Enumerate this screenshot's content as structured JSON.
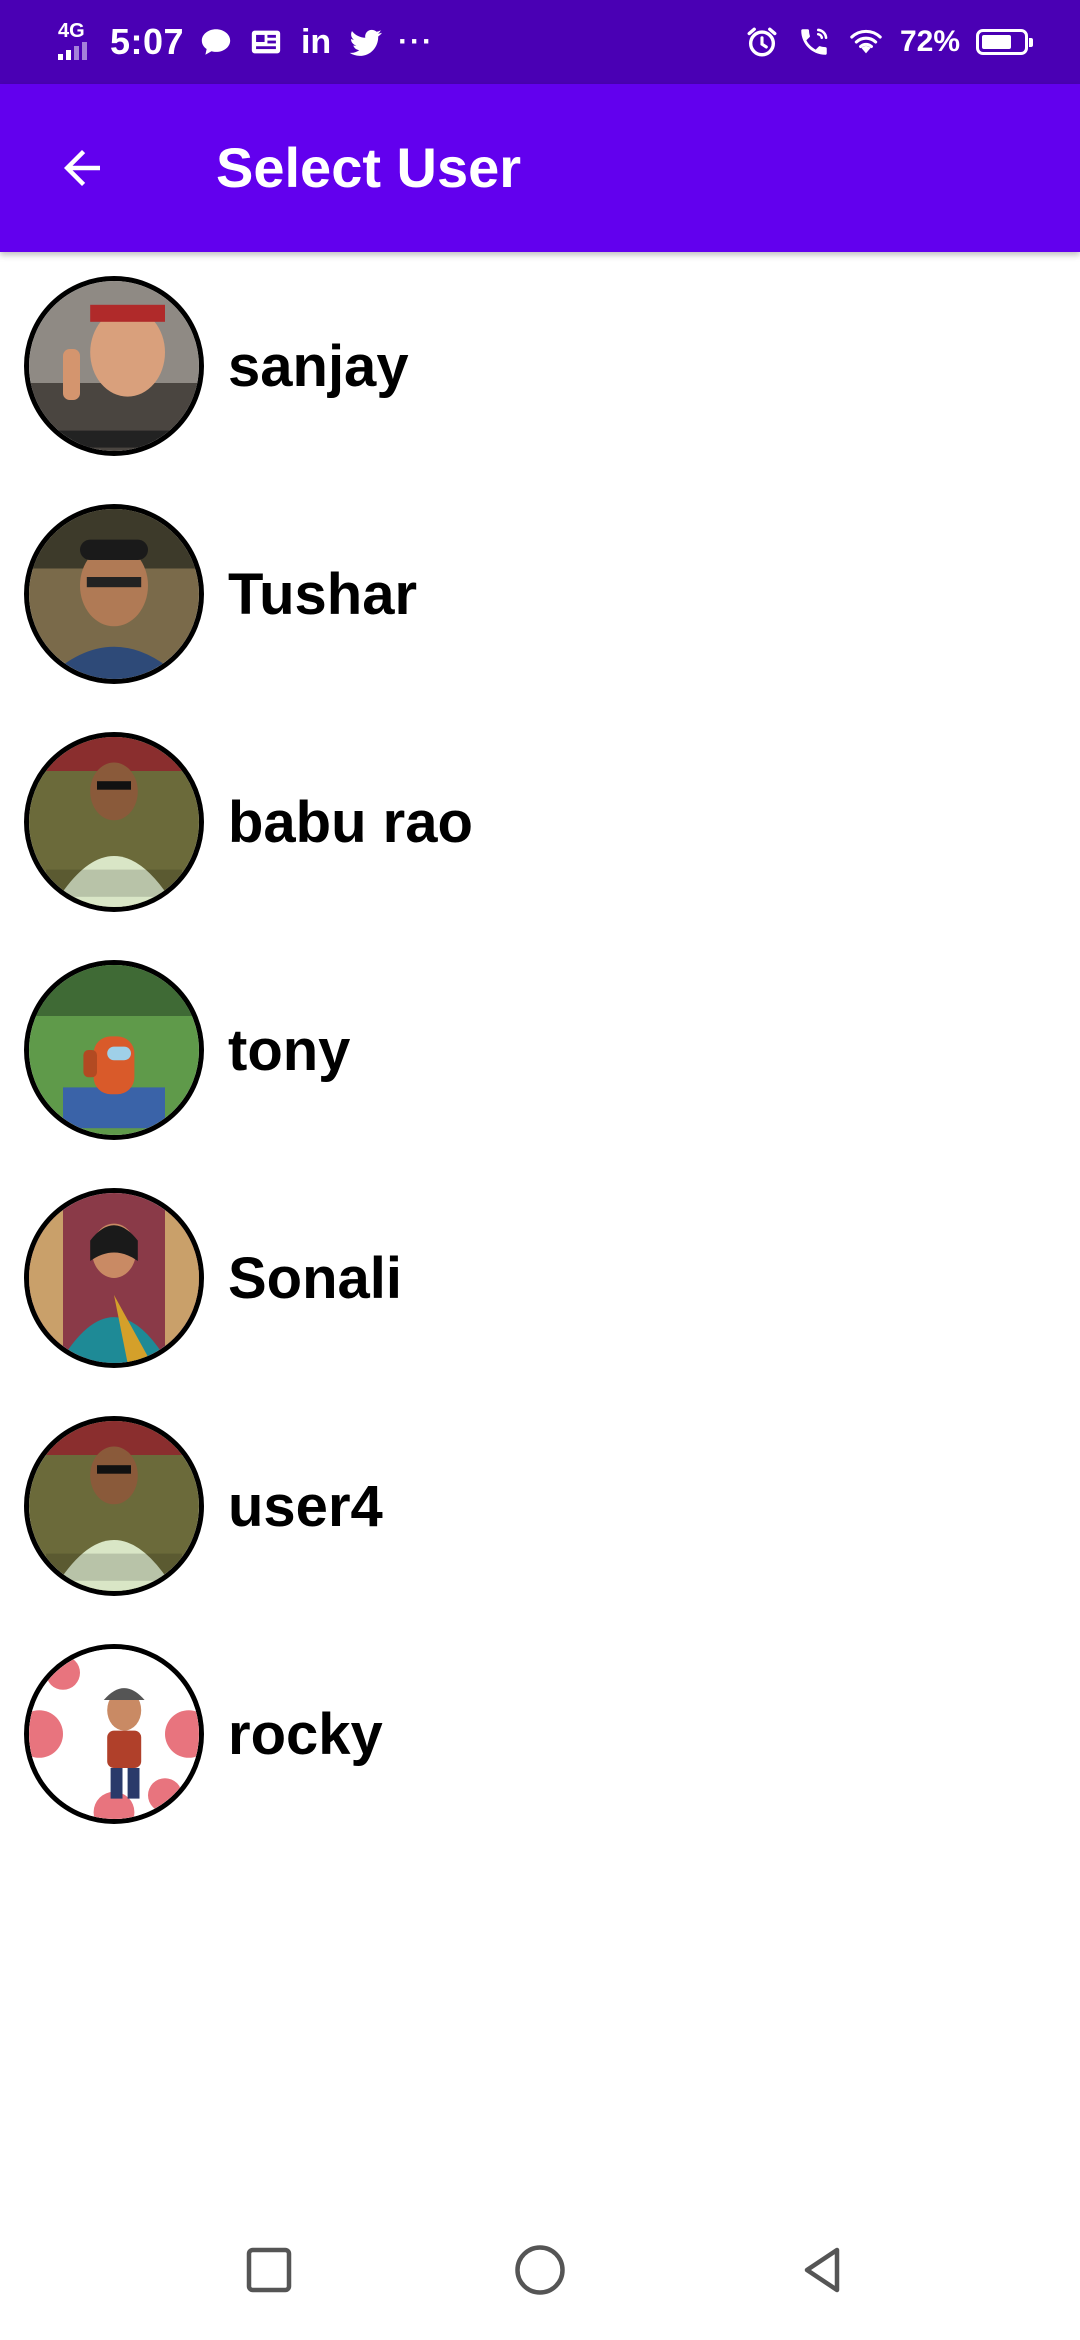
{
  "status_bar": {
    "network": "4G",
    "time": "5:07",
    "battery_percent": "72%",
    "battery_level": 0.72,
    "left_icons": [
      "chat-bubble-icon",
      "news-icon",
      "linkedin-icon",
      "twitter-icon",
      "more-dots-icon"
    ],
    "right_icons": [
      "alarm-icon",
      "wifi-calling-icon",
      "wifi-icon",
      "battery-icon"
    ],
    "linkedin_glyph": "in",
    "more_glyph": "···"
  },
  "app_bar": {
    "title": "Select User",
    "back_icon": "arrow-back-icon",
    "color": "#6200ee"
  },
  "users": [
    {
      "name": "sanjay",
      "avatar_icon": "profile-photo-icon"
    },
    {
      "name": "Tushar",
      "avatar_icon": "profile-photo-icon"
    },
    {
      "name": "babu rao",
      "avatar_icon": "profile-photo-icon"
    },
    {
      "name": "tony",
      "avatar_icon": "profile-photo-icon"
    },
    {
      "name": "Sonali",
      "avatar_icon": "profile-photo-icon"
    },
    {
      "name": "user4",
      "avatar_icon": "profile-photo-icon"
    },
    {
      "name": "rocky",
      "avatar_icon": "profile-photo-icon"
    }
  ],
  "nav_bar": {
    "buttons": [
      "recents-square-icon",
      "home-circle-icon",
      "back-triangle-icon"
    ]
  },
  "colors": {
    "status_bar": "#4a00b4",
    "app_bar": "#6200ee",
    "text": "#000000",
    "background": "#ffffff"
  }
}
